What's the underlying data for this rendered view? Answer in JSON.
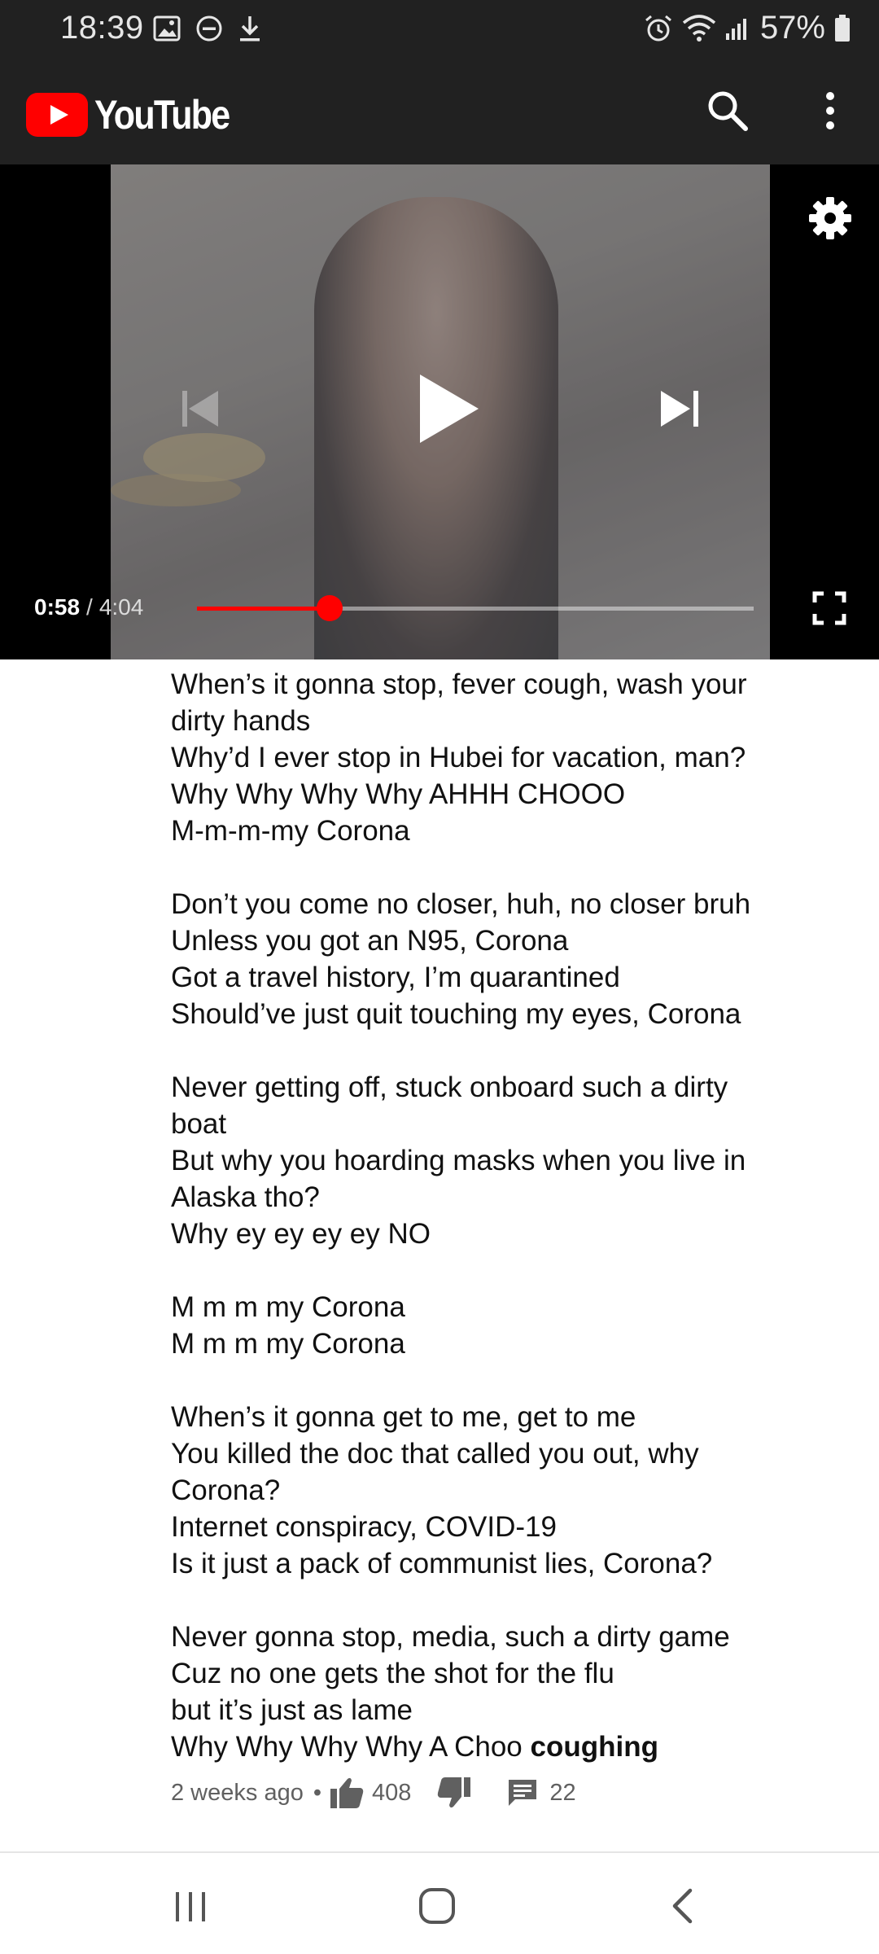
{
  "status_bar": {
    "time": "18:39",
    "left_icons": [
      "gallery-icon",
      "dnd-icon",
      "download-icon"
    ],
    "right_icons": [
      "alarm-icon",
      "wifi-icon",
      "signal-icon"
    ],
    "battery_percent": "57%"
  },
  "app_bar": {
    "logo_text": "YouTube",
    "brand_color": "#ff0000",
    "icons": [
      "search-icon",
      "more-vert-icon"
    ]
  },
  "player": {
    "current_time": "0:58",
    "separator": "/",
    "duration": "4:04",
    "progress_fraction": 0.238,
    "accent_color": "#ff0000",
    "icons": [
      "settings-gear-icon",
      "previous-icon",
      "play-icon",
      "next-icon",
      "fullscreen-icon"
    ]
  },
  "comment": {
    "lines": [
      "When’s it gonna stop, fever cough, wash your dirty hands",
      "Why’d I ever stop in Hubei for vacation, man?",
      "Why Why Why Why AHHH CHOOO",
      "M-m-m-my Corona",
      "",
      "Don’t you come no closer, huh, no closer bruh",
      "Unless you got an N95, Corona",
      "Got a travel history, I’m quarantined",
      "Should’ve just quit touching my eyes, Corona",
      "",
      "Never getting off, stuck onboard such a dirty boat",
      "But why you hoarding masks when you live in Alaska tho?",
      "Why ey ey ey ey NO",
      "",
      "M m m my Corona",
      "M m m my Corona",
      "",
      "When’s it gonna get to me, get to me",
      "You killed the doc that called you out, why Corona?",
      "Internet conspiracy, COVID-19",
      "Is it just a pack of communist lies, Corona?",
      "",
      "Never gonna stop, media, such a dirty game",
      "Cuz no one gets the shot for the flu",
      "but it’s just as lame"
    ],
    "last_line_prefix": "Why Why Why Why A Choo ",
    "last_line_bold": "coughing",
    "age": "2 weeks ago",
    "dot": "•",
    "likes": "408",
    "replies": "22"
  },
  "nav_bar": {
    "icons": [
      "recents-icon",
      "home-icon",
      "back-icon"
    ]
  }
}
